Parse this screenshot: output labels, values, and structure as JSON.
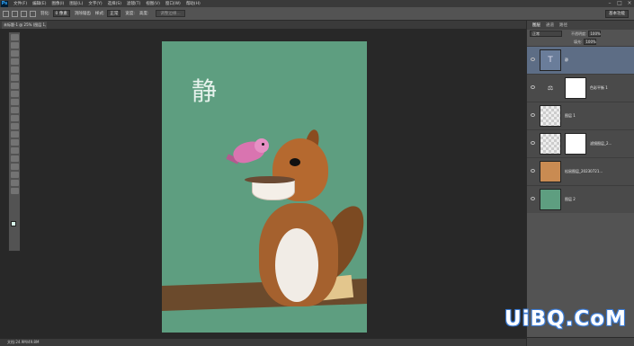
{
  "app": {
    "logo": "Ps"
  },
  "menu": [
    "文件(F)",
    "编辑(E)",
    "图像(I)",
    "图层(L)",
    "文字(Y)",
    "选择(S)",
    "滤镜(T)",
    "视图(V)",
    "窗口(W)",
    "帮助(H)"
  ],
  "options_bar": {
    "feather_label": "羽化:",
    "feather_value": "0 像素",
    "antialias_label": "消除锯齿",
    "style_label": "样式:",
    "style_value": "正常",
    "width_label": "宽度:",
    "height_label": "高度:",
    "refine_button": "调整边缘...",
    "workspace": "基本功能"
  },
  "document": {
    "tab_title": "未标题-1 @ 25% (图层 1, RGB/8) ×"
  },
  "canvas": {
    "text": "静",
    "background": "#5e9e80"
  },
  "panel": {
    "tabs": [
      "图层",
      "通道",
      "路径"
    ],
    "blend_mode": "正常",
    "opacity_label": "不透明度:",
    "opacity_value": "100%",
    "fill_label": "填充:",
    "fill_value": "100%"
  },
  "layers": [
    {
      "name": "静",
      "type": "text"
    },
    {
      "name": "色彩平衡 1",
      "type": "adjustment"
    },
    {
      "name": "图层 1",
      "type": "pixel"
    },
    {
      "name": "滤镜图层_2...",
      "type": "masked"
    },
    {
      "name": "松鼠图层_20230721...",
      "type": "image"
    },
    {
      "name": "图层 2",
      "type": "fill"
    }
  ],
  "status": {
    "text": "文档:24.9M/49.8M"
  },
  "watermark": "UiBQ.CoM"
}
